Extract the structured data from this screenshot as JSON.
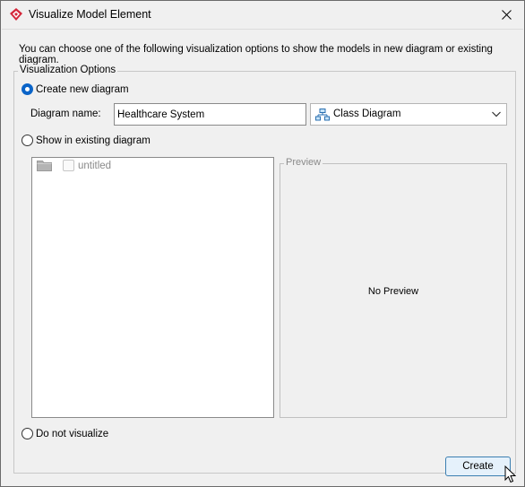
{
  "window": {
    "title": "Visualize Model Element",
    "description": "You can choose one of the following visualization options to show the models in new diagram or existing diagram."
  },
  "options_group": {
    "legend": "Visualization Options",
    "create_new": {
      "label": "Create new diagram",
      "selected": true,
      "name_label": "Diagram name:",
      "name_value": "Healthcare System",
      "type": {
        "icon": "class-diagram-icon",
        "value": "Class Diagram"
      }
    },
    "existing": {
      "label": "Show in existing diagram",
      "selected": false,
      "tree": [
        {
          "label": "untitled",
          "checked": false,
          "enabled": false
        }
      ],
      "preview_legend": "Preview",
      "no_preview": "No Preview"
    },
    "none": {
      "label": "Do not visualize",
      "selected": false
    }
  },
  "actions": {
    "create_label": "Create"
  },
  "colors": {
    "accent": "#0a64c8",
    "app_icon": "#d4283b",
    "button_border": "#3c7fb1"
  }
}
